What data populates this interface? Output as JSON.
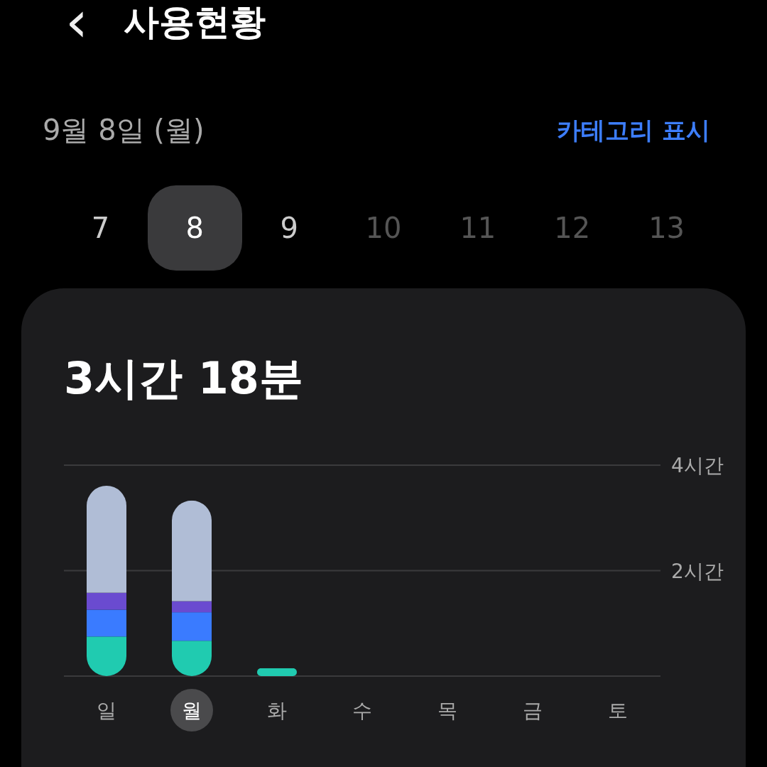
{
  "header": {
    "back": "‹",
    "title": "사용현황"
  },
  "date_label": "9월 8일 (월)",
  "category_link": "카테고리 표시",
  "date_strip": [
    {
      "label": "7",
      "selected": false,
      "disabled": false
    },
    {
      "label": "8",
      "selected": true,
      "disabled": false
    },
    {
      "label": "9",
      "selected": false,
      "disabled": false
    },
    {
      "label": "10",
      "selected": false,
      "disabled": true
    },
    {
      "label": "11",
      "selected": false,
      "disabled": true
    },
    {
      "label": "12",
      "selected": false,
      "disabled": true
    },
    {
      "label": "13",
      "selected": false,
      "disabled": true
    }
  ],
  "usage_card": {
    "total": "3시간 18분",
    "weekday_selected": [
      false,
      true,
      false,
      false,
      false,
      false,
      false
    ],
    "chart_data": {
      "type": "bar",
      "stacked": true,
      "categories": [
        "일",
        "월",
        "화",
        "수",
        "목",
        "금",
        "토"
      ],
      "ylim": [
        0,
        4
      ],
      "yticks": [
        {
          "value": 2,
          "label": "2시간"
        },
        {
          "value": 4,
          "label": "4시간"
        }
      ],
      "series": [
        {
          "color": "#20cbb0",
          "values": [
            0.75,
            0.67,
            0.15,
            null,
            null,
            null,
            null
          ]
        },
        {
          "color": "#3a7bff",
          "values": [
            0.51,
            0.54,
            null,
            null,
            null,
            null,
            null
          ]
        },
        {
          "color": "#6a4bd0",
          "values": [
            0.32,
            0.21,
            null,
            null,
            null,
            null,
            null
          ]
        },
        {
          "color": "#b0bdd6",
          "values": [
            2.03,
            1.91,
            null,
            null,
            null,
            null,
            null
          ]
        }
      ]
    }
  }
}
